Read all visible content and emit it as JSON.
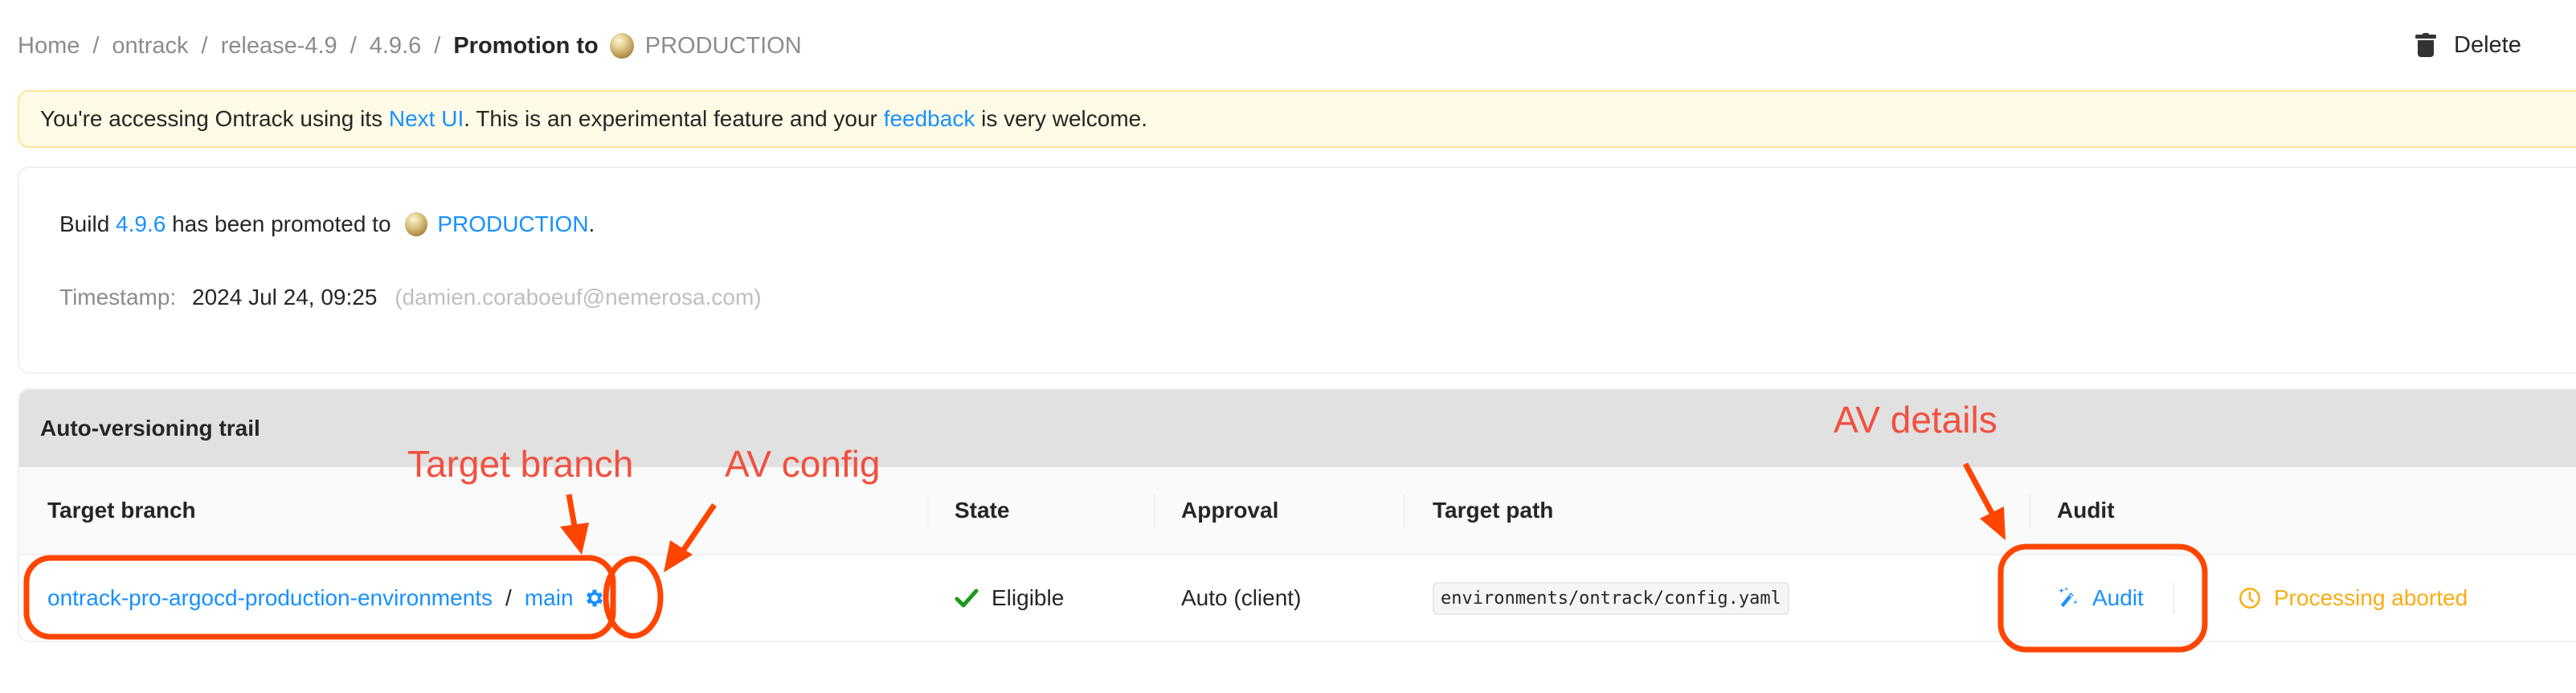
{
  "breadcrumb": {
    "items": [
      "Home",
      "ontrack",
      "release-4.9",
      "4.9.6"
    ],
    "separator": "/",
    "current_prefix": "Promotion to",
    "current_promotion": "PRODUCTION",
    "promotion_icon": "gold-medal-icon"
  },
  "header_actions": {
    "delete_label": "Delete",
    "delete_icon": "trash-icon"
  },
  "banner": {
    "text_before": "You're accessing Ontrack using its ",
    "link1": "Next UI",
    "text_middle": ". This is an experimental feature and your ",
    "link2": "feedback",
    "text_after": " is very welcome.",
    "colors": {
      "background": "#fffbe6",
      "border": "#ffe58f"
    }
  },
  "promotion_info": {
    "text_build": "Build ",
    "build_link": "4.9.6",
    "text_promoted": " has been promoted to ",
    "promotion_link": "PRODUCTION",
    "text_end": ".",
    "timestamp_label": "Timestamp:",
    "timestamp_value": "2024 Jul 24, 09:25",
    "timestamp_user": "(damien.coraboeuf@nemerosa.com)"
  },
  "av_trail": {
    "title": "Auto-versioning trail",
    "columns": [
      "Target branch",
      "State",
      "Approval",
      "Target path",
      "Audit"
    ],
    "rows": [
      {
        "project": "ontrack-pro-argocd-production-environments",
        "separator": "/",
        "branch": "main",
        "config_icon": "gear-icon",
        "state": "Eligible",
        "state_icon": "check-icon",
        "approval": "Auto (client)",
        "target_path": "environments/ontrack/config.yaml",
        "audit_label": "Audit",
        "audit_icon": "magic-wand-icon",
        "audit_status": "Processing aborted",
        "audit_status_icon": "clock-icon"
      }
    ]
  },
  "annotations": {
    "target_branch": "Target branch",
    "av_config": "AV config",
    "av_details": "AV details",
    "color": "#ff4500"
  },
  "colors": {
    "link": "#1890ff",
    "success": "#1a9a1a",
    "warning": "#faad14",
    "muted": "#8c8c8c"
  }
}
